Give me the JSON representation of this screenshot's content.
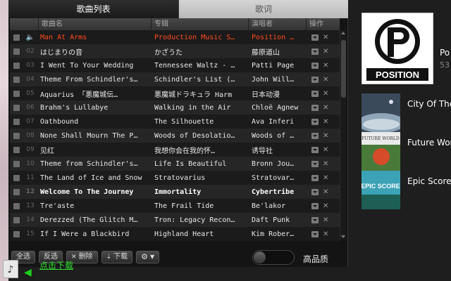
{
  "tabs": {
    "list": "歌曲列表",
    "lyrics": "歌词"
  },
  "columns": {
    "title": "歌曲名",
    "album": "专辑",
    "artist": "演唱者",
    "ops": "操作"
  },
  "tracks": [
    {
      "num": "",
      "title": "Man At Arms",
      "album": "Production Music S…",
      "artist": "Position …",
      "playing": true
    },
    {
      "num": "02",
      "title": "はじまりの音",
      "album": "かざうた",
      "artist": "藤原道山"
    },
    {
      "num": "03",
      "title": "I Went To Your Wedding",
      "album": "Tennessee Waltz - …",
      "artist": "Patti Page"
    },
    {
      "num": "04",
      "title": "Theme From Schindler's…",
      "album": "Schindler's List (…",
      "artist": "John Will…"
    },
    {
      "num": "05",
      "title": "Aquarius 「悪魔城伝…",
      "album": "悪魔城ドラキュラ Harm",
      "artist": "日本动漫"
    },
    {
      "num": "06",
      "title": "Brahm's Lullabye",
      "album": "Walking in the Air",
      "artist": "Chloë Agnew"
    },
    {
      "num": "07",
      "title": "Oathbound",
      "album": "The Silhouette",
      "artist": "Ava Inferi"
    },
    {
      "num": "08",
      "title": "None Shall Mourn The P…",
      "album": "Woods of Desolatio…",
      "artist": "Woods of …"
    },
    {
      "num": "09",
      "title": "见红",
      "album": "我想你会在我的怀…",
      "artist": "诱导社"
    },
    {
      "num": "10",
      "title": "Theme from Schindler's…",
      "album": "Life Is Beautiful",
      "artist": "Bronn Jou…"
    },
    {
      "num": "11",
      "title": "The Land of Ice and Snow",
      "album": "Stratovarius",
      "artist": "Stratovar…"
    },
    {
      "num": "12",
      "title": "Welcome To The Journey",
      "album": "Immortality",
      "artist": "Cybertribe",
      "bold": true
    },
    {
      "num": "13",
      "title": "Tre'aste",
      "album": "The Frail Tide",
      "artist": "Be'lakor"
    },
    {
      "num": "14",
      "title": "Derezzed (The Glitch M…",
      "album": "Tron: Legacy Recon…",
      "artist": "Daft Punk"
    },
    {
      "num": "15",
      "title": "If I Were a Blackbird",
      "album": "Highland Heart",
      "artist": "Kim Rober…"
    }
  ],
  "toolbar": {
    "select_all": "全选",
    "invert": "反选",
    "delete": "删除",
    "download": "下载",
    "delete_icon": "x-icon",
    "download_icon": "download-icon",
    "settings_icon": "gear-icon"
  },
  "quality": {
    "label": "高品质"
  },
  "download_prompt": {
    "link": "点击下载",
    "icon": "music-note-icon"
  },
  "artist": {
    "name": "Po",
    "count": "53",
    "logo_text": "POSITION",
    "logo_letter": "P"
  },
  "albums": [
    {
      "title": "City Of The"
    },
    {
      "title": "Future Work",
      "thumb_text": "FUTURE WORLD"
    },
    {
      "title": "Epic Score",
      "thumb_text": "EPIC SCORE"
    }
  ],
  "colors": {
    "playing": "#ff4b1f",
    "link": "#2ee02e",
    "background": "#141414"
  }
}
